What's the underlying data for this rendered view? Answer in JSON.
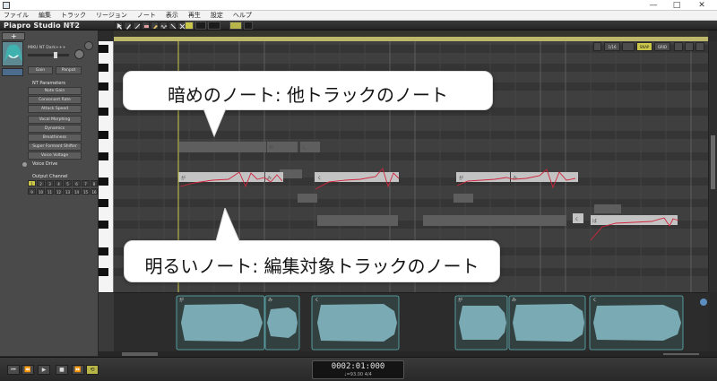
{
  "window": {
    "icon": "app-window-icon",
    "controls": [
      "—",
      "□",
      "✕"
    ]
  },
  "menu": [
    "ファイル",
    "編集",
    "トラック",
    "リージョン",
    "ノート",
    "表示",
    "再生",
    "設定",
    "ヘルプ"
  ],
  "toolbar": {
    "logo": "Piapro Studio NT2",
    "version": "1.0.0",
    "tool_icons": [
      "pointer-icon",
      "pencil-icon",
      "line-icon",
      "eraser-icon",
      "brush-icon",
      "vibrato-icon",
      "knife-icon",
      "cross-icon"
    ]
  },
  "left_panel": {
    "voice_name": "MIKU NT Dark+++",
    "gain_label": "Gain",
    "panpot_label": "Panpot",
    "nt_parameters_heading": "NT Parameters",
    "parameter_buttons": [
      "Note Gain",
      "Consonant Rate",
      "Attack Speed",
      "Vocal Morphing",
      "Dynamics",
      "Breathiness",
      "Super Formant Shifter",
      "Voice Voltage"
    ],
    "voice_drive_heading": "Voice Drive",
    "output_channel_heading": "Output Channel",
    "channels_row1": [
      "1",
      "2",
      "3",
      "4",
      "5",
      "6",
      "7",
      "8"
    ],
    "channels_row2": [
      "9",
      "10",
      "11",
      "12",
      "13",
      "14",
      "15",
      "16"
    ],
    "selected_channel": "1",
    "add_track_symbol": "+"
  },
  "editor_toolbar": {
    "buttons": [
      "1/16",
      "SNAP",
      "GRID"
    ]
  },
  "notes": {
    "dark_labels": [
      "ね",
      "し"
    ],
    "bright_labels": [
      "が",
      "み",
      "く",
      "が",
      "み",
      "く",
      "ば"
    ]
  },
  "waveform": {
    "region_labels": [
      "が",
      "み",
      "く",
      "が",
      "み",
      "く"
    ]
  },
  "transport": {
    "buttons": [
      "⏮",
      "⏪",
      "▶",
      "■",
      "⏩",
      "⟲"
    ],
    "time": "0002:01:000",
    "tempo": "♩=93.00",
    "signature": "4/4"
  },
  "callouts": {
    "top": "暗めのノート: 他トラックのノート",
    "bottom": "明るいノート: 編集対象トラックのノート"
  },
  "colors": {
    "dark_note": "#5e5e5e",
    "bright_note": "#c3c3c3",
    "pitch_curve": "#d0243c",
    "playhead": "#c8c84a",
    "waveform": "#7aaab4",
    "region_border": "#5fb2b8"
  }
}
